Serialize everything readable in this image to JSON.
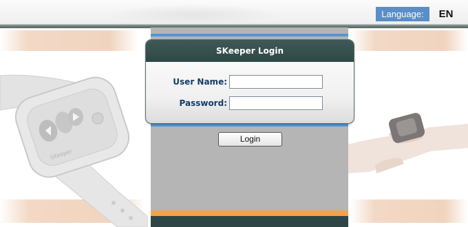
{
  "header": {
    "language_label": "Language:",
    "language_value": "EN"
  },
  "login": {
    "title": "SKeeper Login",
    "username_label": "User Name:",
    "username_value": "",
    "password_label": "Password:",
    "password_value": "",
    "button_label": "Login"
  },
  "colors": {
    "accent_blue": "#4f97d9",
    "card_header": "#2e4846",
    "label_text": "#123c66",
    "orange_strip": "#f3a24a",
    "column_gray": "#b5b5b5"
  },
  "illustration": {
    "left": "wrist-watch-device",
    "right": "arm-wearing-device"
  }
}
